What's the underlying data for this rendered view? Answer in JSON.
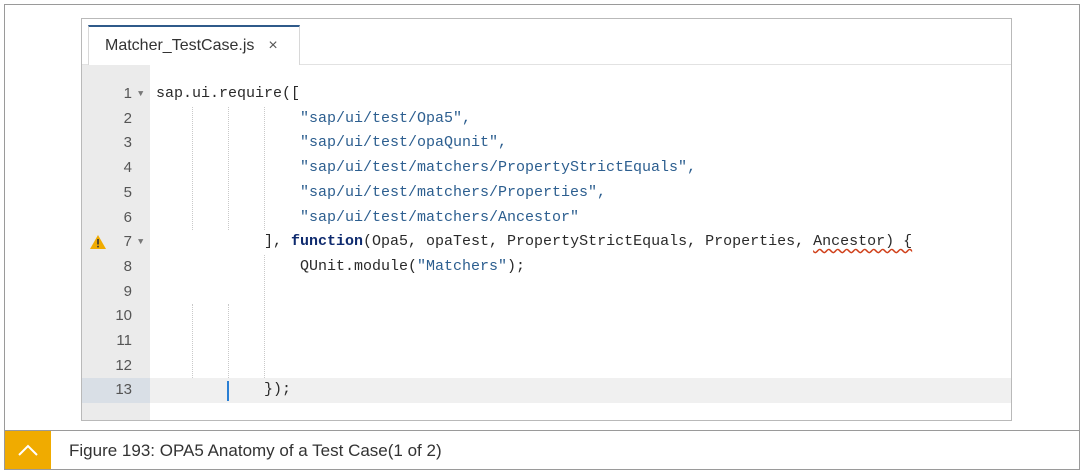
{
  "tab": {
    "filename": "Matcher_TestCase.js",
    "close_glyph": "×"
  },
  "editor": {
    "active_line": 13,
    "lines": [
      {
        "num": "1",
        "fold": true,
        "warning": false
      },
      {
        "num": "2",
        "fold": false,
        "warning": false
      },
      {
        "num": "3",
        "fold": false,
        "warning": false
      },
      {
        "num": "4",
        "fold": false,
        "warning": false
      },
      {
        "num": "5",
        "fold": false,
        "warning": false
      },
      {
        "num": "6",
        "fold": false,
        "warning": false
      },
      {
        "num": "7",
        "fold": true,
        "warning": true
      },
      {
        "num": "8",
        "fold": false,
        "warning": false
      },
      {
        "num": "9",
        "fold": false,
        "warning": false
      },
      {
        "num": "10",
        "fold": false,
        "warning": false
      },
      {
        "num": "11",
        "fold": false,
        "warning": false
      },
      {
        "num": "12",
        "fold": false,
        "warning": false
      },
      {
        "num": "13",
        "fold": false,
        "warning": false
      }
    ],
    "code": {
      "l1": "sap.ui.require([",
      "l2": "\"sap/ui/test/Opa5\",",
      "l3": "\"sap/ui/test/opaQunit\",",
      "l4": "\"sap/ui/test/matchers/PropertyStrictEquals\",",
      "l5": "\"sap/ui/test/matchers/Properties\",",
      "l6": "\"sap/ui/test/matchers/Ancestor\"",
      "l7_pre": "], ",
      "l7_kw": "function",
      "l7_args": "(Opa5, opaTest, PropertyStrictEquals, Properties, ",
      "l7_squig": "Ancestor) {",
      "l8_pre": "QUnit.module(",
      "l8_str": "\"Matchers\"",
      "l8_post": ");",
      "l13": "});"
    }
  },
  "caption": {
    "text": "Figure 193: OPA5 Anatomy of a Test Case(1 of 2)",
    "accent": "#f0ab00"
  },
  "colors": {
    "string": "#2c5e8f",
    "keyword": "#0e2a6e",
    "warning": "#f0ab00"
  }
}
